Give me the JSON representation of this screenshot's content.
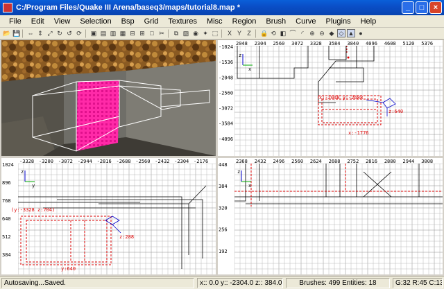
{
  "window": {
    "title": "C:/Program Files/Quake III Arena/baseq3/maps/tutorial8.map *"
  },
  "menu": [
    "File",
    "Edit",
    "View",
    "Selection",
    "Bsp",
    "Grid",
    "Textures",
    "Misc",
    "Region",
    "Brush",
    "Curve",
    "Plugins",
    "Help"
  ],
  "toolbar_icons": [
    "open-icon",
    "save-icon",
    "flip-x-icon",
    "flip-y-icon",
    "flip-z-icon",
    "rotate-x-icon",
    "rotate-y-icon",
    "rotate-z-icon",
    "select-complete-icon",
    "select-touching-icon",
    "select-partial-icon",
    "select-inside-icon",
    "csg-subtract-icon",
    "csg-merge-icon",
    "hollow-icon",
    "clipper-icon",
    "change-view-icon",
    "texture-view-icon",
    "camera-icon",
    "entity-icon",
    "cube-clip-icon",
    "x-view-icon",
    "y-view-icon",
    "z-view-icon",
    "texture-lock-icon",
    "rotate-lock-icon",
    "cap-icon",
    "patch-icon",
    "patch-bend-icon",
    "patch-insert-icon",
    "patch-delete-icon",
    "drag-vertex-icon",
    "drag-edge-icon",
    "drag-face-icon",
    "red-cursor-icon"
  ],
  "views": {
    "xz": {
      "x_ticks": [
        "2048",
        "2304",
        "2560",
        "3072",
        "3328",
        "3584",
        "3840",
        "4096",
        "4608",
        "5120",
        "5376"
      ],
      "y_ticks": [
        "-1024",
        "-1536",
        "-2048",
        "-2560",
        "-3072",
        "-3584",
        "-4096"
      ],
      "axis_label": "x z",
      "labels": [
        "x:-2048 y:-2688",
        "z:640",
        "x:-1776"
      ]
    },
    "yz": {
      "x_ticks": [
        "-3328",
        "-3200",
        "-3072",
        "-2944",
        "-2816",
        "-2688",
        "-2560",
        "-2432",
        "-2304",
        "-2176"
      ],
      "y_ticks": [
        "1024",
        "896",
        "768",
        "640",
        "512",
        "384"
      ],
      "axis_label": "z y",
      "labels": [
        "(y:-3328 z:704)",
        "z:288",
        "y:640"
      ]
    },
    "xy": {
      "x_ticks": [
        "2368",
        "2432",
        "2496",
        "2560",
        "2624",
        "2688",
        "2752",
        "2816",
        "2880",
        "2944",
        "3008"
      ],
      "y_ticks": [
        "448",
        "384",
        "320",
        "256",
        "192"
      ],
      "axis_label": "x z"
    }
  },
  "status": {
    "message": "Autosaving...Saved.",
    "coords": "x:: 0.0  y:: -2304.0  z:: 384.0",
    "counts": "Brushes: 499 Entities: 18",
    "grid": "G:32 R:45 C:13 L:MR"
  }
}
